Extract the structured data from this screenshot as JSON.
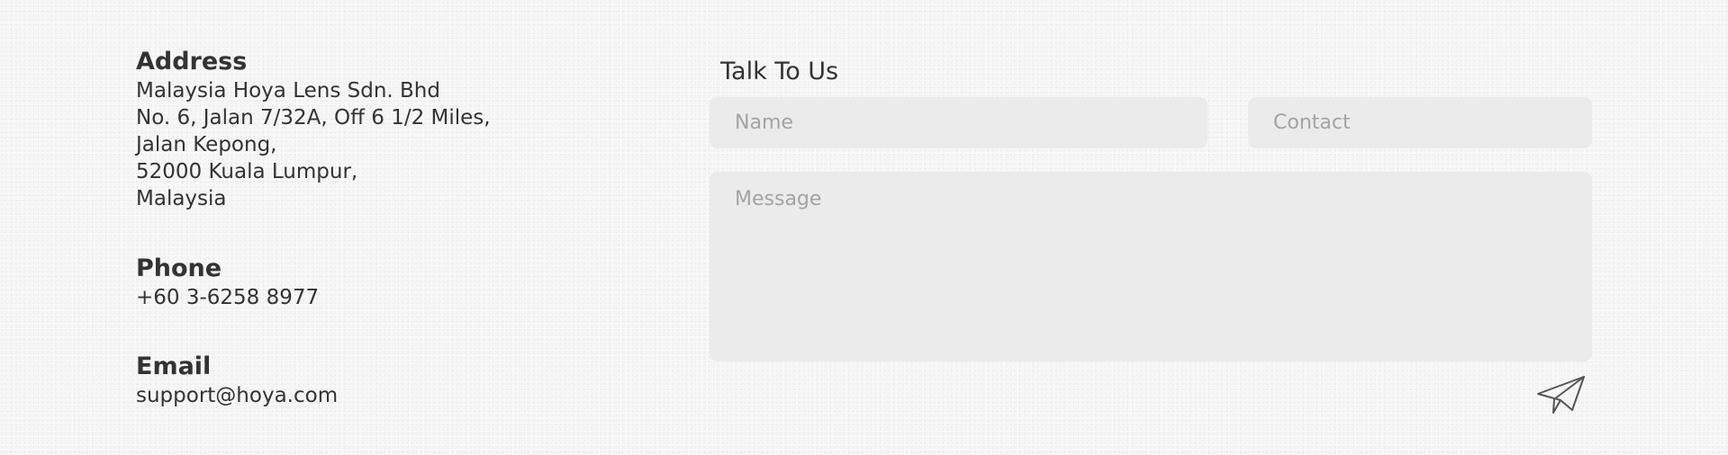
{
  "address": {
    "heading": "Address",
    "lines": [
      "Malaysia Hoya Lens Sdn. Bhd",
      "No. 6, Jalan 7/32A, Off 6 1/2 Miles,",
      "Jalan Kepong,",
      "52000 Kuala Lumpur,",
      "Malaysia"
    ]
  },
  "phone": {
    "heading": "Phone",
    "value": "+60 3-6258 8977"
  },
  "email": {
    "heading": "Email",
    "value": "support@hoya.com"
  },
  "form": {
    "title": "Talk To Us",
    "name_placeholder": "Name",
    "contact_placeholder": "Contact",
    "message_placeholder": "Message",
    "send_icon": "paper-plane-icon"
  },
  "colors": {
    "text": "#333333",
    "field_bg": "#ebebeb",
    "placeholder": "#a3a3a3",
    "page_bg": "#f4f4f4"
  }
}
